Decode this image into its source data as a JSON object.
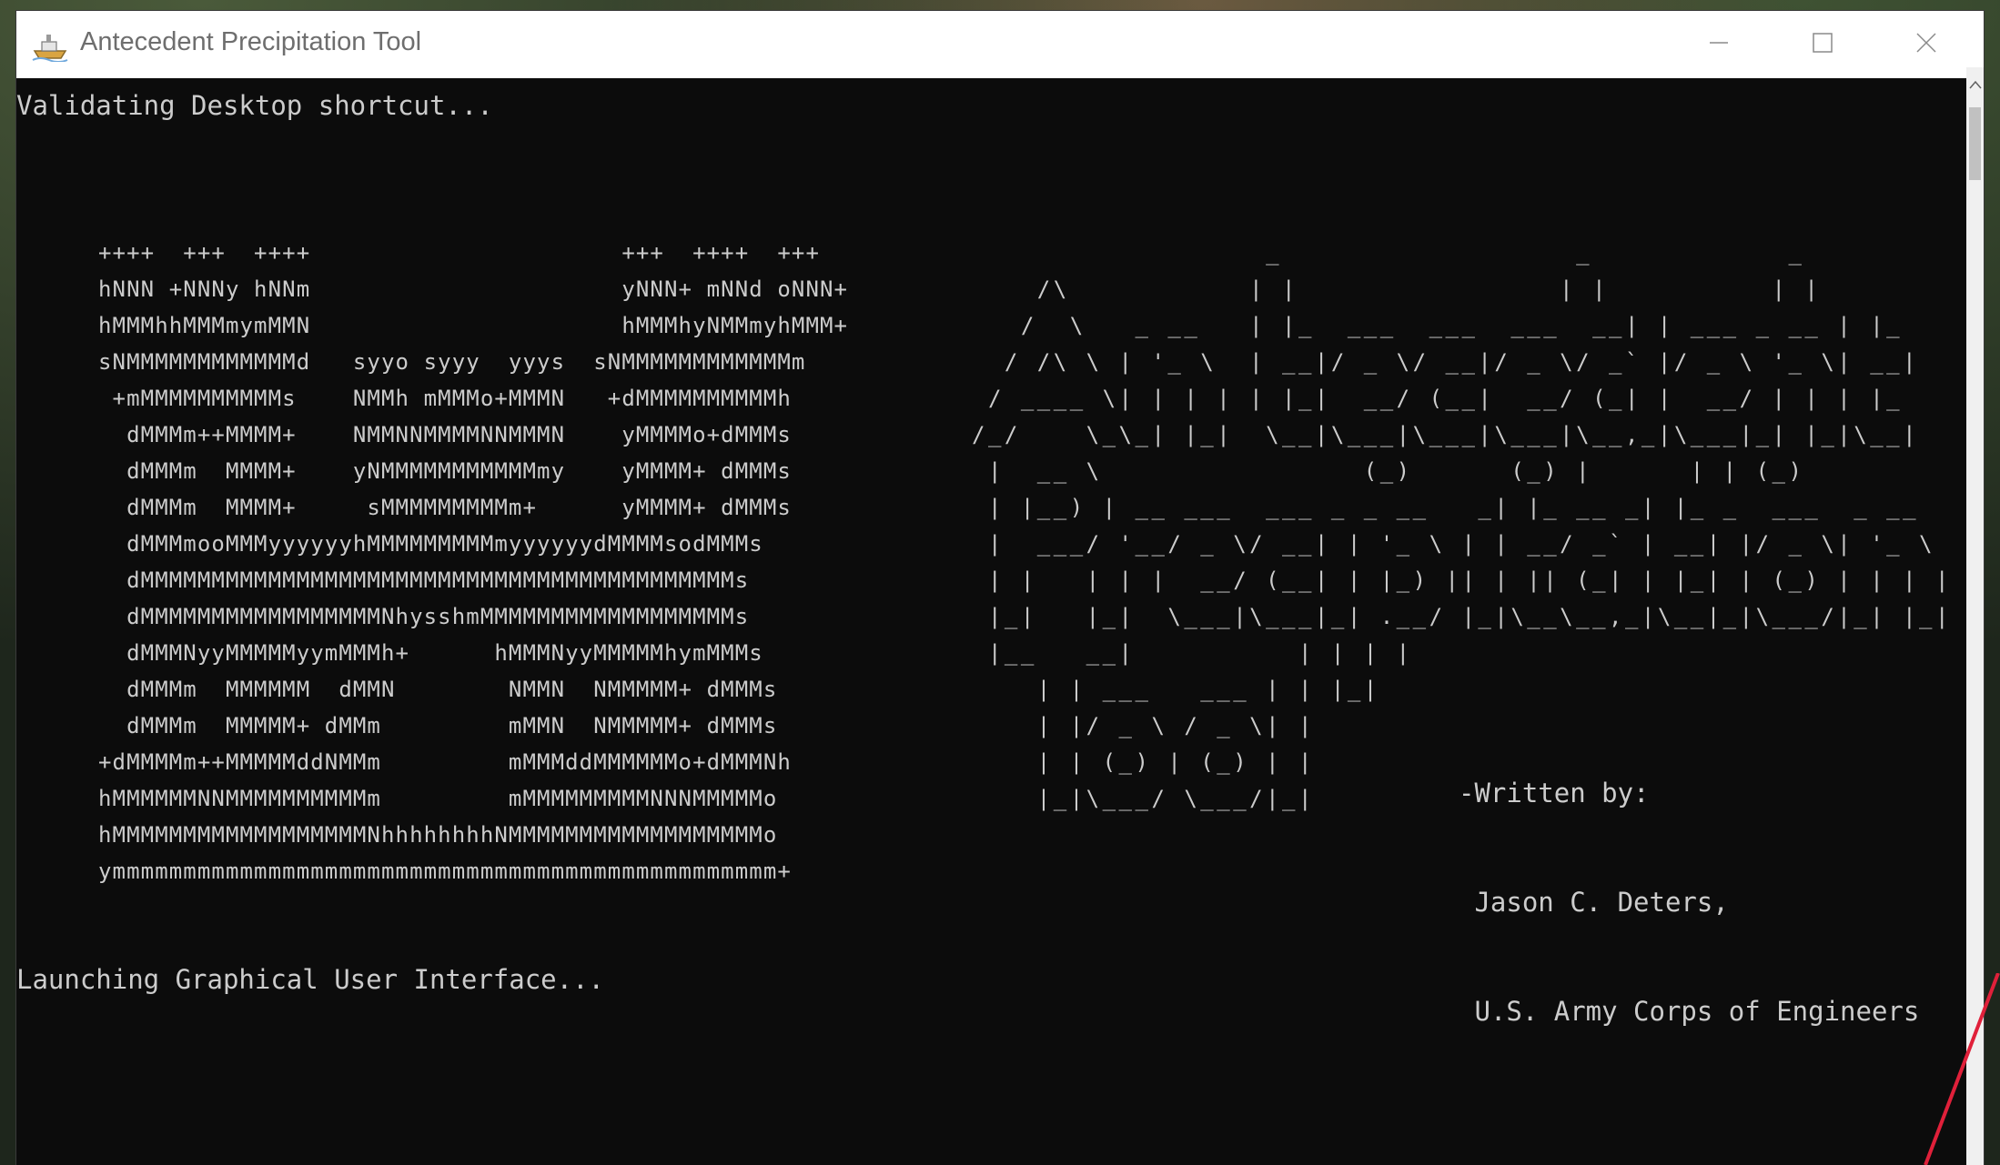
{
  "window": {
    "title": "Antecedent Precipitation Tool",
    "icon": "app-ship-icon",
    "controls": {
      "minimize_icon": "minimize-icon",
      "maximize_icon": "maximize-icon",
      "close_icon": "close-icon"
    }
  },
  "console": {
    "line_validating": "Validating Desktop shortcut...",
    "logo_art": "++++  +++  ++++                      +++  ++++  +++\nhNNN +NNNy hNNm                      yNNN+ mNNd oNNN+\nhMMMhhMMMmymMMN                      hMMMhyNMMmyhMMM+\nsNMMMMMMMMMMMMd   syyo syyy  yyys  sNMMMMMMMMMMMMm\n +mMMMMMMMMMMs    NMMh mMMMo+MMMN   +dMMMMMMMMMMh\n  dMMMm++MMMM+    NMMNNMMMMNNMMMN    yMMMMo+dMMMs\n  dMMMm  MMMM+    yNMMMMMMMMMMMmy    yMMMM+ dMMMs\n  dMMMm  MMMM+     sMMMMMMMMMm+      yMMMM+ dMMMs\n  dMMMmooMMMyyyyyyhMMMMMMMMMmyyyyyydMMMMsodMMMs\n  dMMMMMMMMMMMMMMMMMMMMMMMMMMMMMMMMMMMMMMMMMMs\n  dMMMMMMMMMMMMMMMMMNhysshmMMMMMMMMMMMMMMMMMMs\n  dMMMNyyMMMMMyymMMMh+      hMMMNyyMMMMMhymMMMs\n  dMMMm  MMMMMM  dMMN        NMMN  NMMMMM+ dMMMs\n  dMMMm  MMMMM+ dMMm         mMMN  NMMMMM+ dMMMs\n+dMMMMm++MMMMMddNMMm         mMMMddMMMMMMo+dMMMNh\nhMMMMMMNNMMMMMMMMMMm         mMMMMMMMMMNNNMMMMMo\nhMMMMMMMMMMMMMMMMMMNhhhhhhhhNMMMMMMMMMMMMMMMMMMo\nymmmmmmmmmmmmmmmmmmmmmmmmmmmmmmmmmmmmmmmmmmmmmmm+",
    "title_art": "                  _                  _            _\n    /\\           | |                | |          | |\n   /  \\   _ __   | |_  ___  ___  ___  __| | ___ _ __ | |_\n  / /\\ \\ | '_ \\  | __|/ _ \\/ __|/ _ \\/ _` |/ _ \\ '_ \\| __|\n / ____ \\| | | | | |_|  __/ (__|  __/ (_| |  __/ | | | |_\n/_/    \\_\\_| |_|  \\__|\\___|\\___|\\___|\\__,_|\\___|_| |_|\\__|\n |  __ \\                (_)      (_) |      | | (_)\n | |__) | __ ___  ___ _ _ __   _| |_ __ _| |_ _  ___  _ __\n |  ___/ '__/ _ \\/ __| | '_ \\ | | __/ _` | __| |/ _ \\| '_ \\\n | |   | | |  __/ (__| | |_) || | || (_| | |_| | (_) | | | |\n |_|   |_|  \\___|\\___|_| .__/ |_|\\__\\__,_|\\__|_|\\___/|_| |_|\n |__   __|          | | | |\n    | | ___   ___ | | |_|\n    | |/ _ \\ / _ \\| |\n    | | (_) | (_) | |\n    |_|\\___/ \\___/|_|",
    "credit_line_1": "-Written by:",
    "credit_line_2": " Jason C. Deters,",
    "credit_line_3": " U.S. Army Corps of Engineers",
    "line_launching": "Launching Graphical User Interface..."
  },
  "scrollbar": {
    "up_arrow_icon": "scroll-up-arrow-icon"
  },
  "colors": {
    "console_bg": "#0c0c0c",
    "console_text": "#cccccc",
    "titlebar_bg": "#ffffff",
    "title_text": "#6e6e6e",
    "annotation_red": "#e0203a"
  }
}
